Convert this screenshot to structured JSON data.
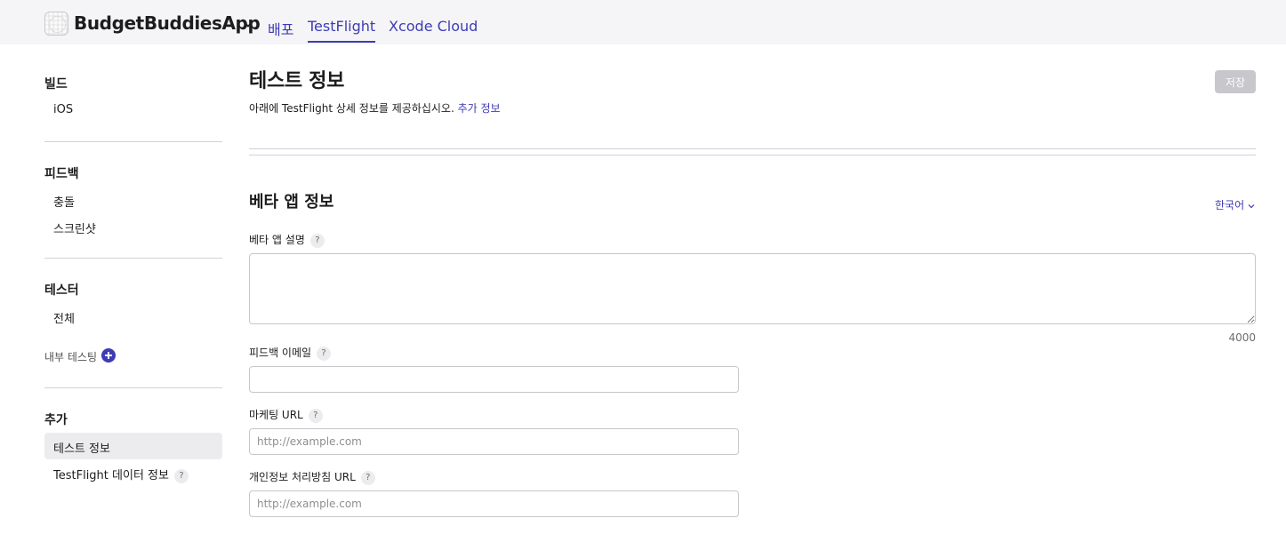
{
  "header": {
    "app_name": "BudgetBuddiesApp",
    "nav": [
      {
        "label": "배포",
        "active": false
      },
      {
        "label": "TestFlight",
        "active": true
      },
      {
        "label": "Xcode Cloud",
        "active": false
      }
    ]
  },
  "sidebar": {
    "builds": {
      "heading": "빌드",
      "items": [
        "iOS"
      ]
    },
    "feedback": {
      "heading": "피드백",
      "items": [
        "충돌",
        "스크린샷"
      ]
    },
    "testers": {
      "heading": "테스터",
      "items": [
        "전체"
      ],
      "internal_testing": "내부 테스팅"
    },
    "additional": {
      "heading": "추가",
      "items": [
        "테스트 정보",
        "TestFlight 데이터 정보"
      ],
      "selected": "테스트 정보"
    }
  },
  "main": {
    "title": "테스트 정보",
    "subtitle": "아래에 TestFlight 상세 정보를 제공하십시오.",
    "subtitle_link": "추가 정보",
    "save_label": "저장",
    "section_title": "베타 앱 정보",
    "language": "한국어",
    "fields": {
      "description": {
        "label": "베타 앱 설명",
        "value": "",
        "char_limit": "4000"
      },
      "feedback_email": {
        "label": "피드백 이메일",
        "value": "",
        "placeholder": ""
      },
      "marketing_url": {
        "label": "마케팅 URL",
        "value": "",
        "placeholder": "http://example.com"
      },
      "privacy_url": {
        "label": "개인정보 처리방침 URL",
        "value": "",
        "placeholder": "http://example.com"
      }
    }
  },
  "help_badge": "?",
  "colors": {
    "accent": "#3e3bb5",
    "topbar_bg": "#f5f5f7",
    "save_disabled": "#c7c7cc",
    "selected_bg": "#ececef"
  }
}
